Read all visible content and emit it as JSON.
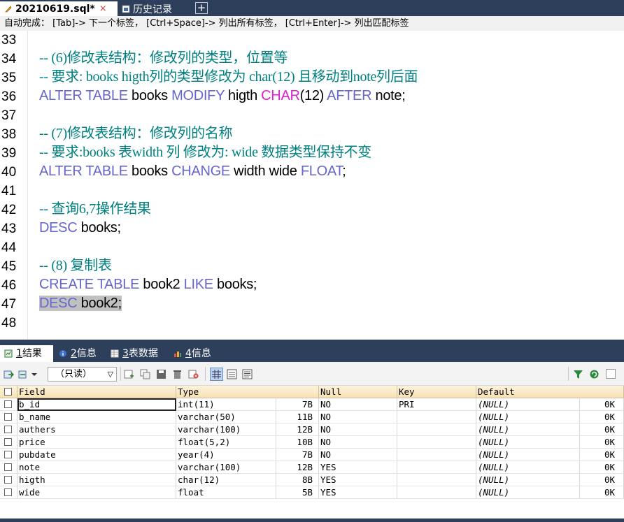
{
  "tabs": {
    "active_title": "20210619.sql*",
    "active_close": "×",
    "history_title": "历史记录",
    "add_label": "+"
  },
  "hint": "自动完成： [Tab]-> 下一个标签， [Ctrl+Space]-> 列出所有标签， [Ctrl+Enter]-> 列出匹配标签",
  "editor": {
    "line_numbers": [
      "33",
      "34",
      "35",
      "36",
      "37",
      "38",
      "39",
      "40",
      "41",
      "42",
      "43",
      "44",
      "45",
      "46",
      "47",
      "48"
    ],
    "l34": "-- (6)修改表结构：修改列的类型，位置等",
    "l35": "-- 要求: books higth列的类型修改为 char(12) 且移动到note列后面",
    "l36": {
      "k1": "ALTER TABLE",
      "i1": " books ",
      "k2": "MODIFY",
      "i2": " higth ",
      "t1": "CHAR",
      "i3": "(12) ",
      "k3": "AFTER",
      "i4": " note;"
    },
    "l38": "-- (7)修改表结构：修改列的名称",
    "l39": "-- 要求:books 表width 列 修改为: wide 数据类型保持不变",
    "l40": {
      "k1": "ALTER TABLE",
      "i1": " books ",
      "k2": "CHANGE",
      "i2": " width wide ",
      "k3": "FLOAT",
      "i3": ";"
    },
    "l42": "-- 查询6,7操作结果",
    "l43": {
      "k1": "DESC",
      "i1": " books;"
    },
    "l45": "-- (8) 复制表",
    "l46": {
      "k1": "CREATE TABLE",
      "i1": " book2 ",
      "k2": "LIKE",
      "i2": " books;"
    },
    "l47": {
      "k1": "DESC",
      "i1": " book2;"
    }
  },
  "result_tabs": [
    {
      "num": "1",
      "label": " 结果"
    },
    {
      "num": "2",
      "label": " 信息"
    },
    {
      "num": "3",
      "label": " 表数据"
    },
    {
      "num": "4",
      "label": " 信息"
    }
  ],
  "toolbar": {
    "readonly": "（只读）"
  },
  "grid": {
    "headers": [
      "Field",
      "Type",
      "Null",
      "Key",
      "Default"
    ],
    "rows": [
      {
        "field": "b_id",
        "type": "int(11)",
        "tsize": "7B",
        "null": "NO",
        "key": "PRI",
        "default": "(NULL)",
        "dsize": "0K"
      },
      {
        "field": "b_name",
        "type": "varchar(50)",
        "tsize": "11B",
        "null": "NO",
        "key": "",
        "default": "(NULL)",
        "dsize": "0K"
      },
      {
        "field": "authers",
        "type": "varchar(100)",
        "tsize": "12B",
        "null": "NO",
        "key": "",
        "default": "(NULL)",
        "dsize": "0K"
      },
      {
        "field": "price",
        "type": "float(5,2)",
        "tsize": "10B",
        "null": "NO",
        "key": "",
        "default": "(NULL)",
        "dsize": "0K"
      },
      {
        "field": "pubdate",
        "type": "year(4)",
        "tsize": "7B",
        "null": "NO",
        "key": "",
        "default": "(NULL)",
        "dsize": "0K"
      },
      {
        "field": "note",
        "type": "varchar(100)",
        "tsize": "12B",
        "null": "YES",
        "key": "",
        "default": "(NULL)",
        "dsize": "0K"
      },
      {
        "field": "higth",
        "type": "char(12)",
        "tsize": "8B",
        "null": "YES",
        "key": "",
        "default": "(NULL)",
        "dsize": "0K"
      },
      {
        "field": "wide",
        "type": "float",
        "tsize": "5B",
        "null": "YES",
        "key": "",
        "default": "(NULL)",
        "dsize": "0K"
      }
    ]
  }
}
